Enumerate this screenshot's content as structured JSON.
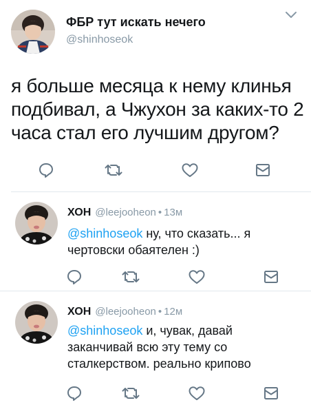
{
  "colors": {
    "text": "#14171a",
    "secondary": "#8899a6",
    "mention": "#1da1f2",
    "divider": "#e1e8ed"
  },
  "main_tweet": {
    "display_name": "ФБР тут искать нечего",
    "handle": "@shinhoseok",
    "text": "я больше месяца к нему клинья подбивал, а Чжухон за каких-то 2 часа стал его лучшим другом?",
    "menu_icon": "chevron-down-icon",
    "actions": [
      "reply-icon",
      "retweet-icon",
      "like-icon",
      "message-icon"
    ]
  },
  "replies": [
    {
      "display_name": "ХОН",
      "handle": "@leejooheon",
      "separator": "•",
      "time": "13м",
      "mention": "@shinhoseok",
      "text": " ну, что сказать... я чертовски обаятелен :)"
    },
    {
      "display_name": "ХОН",
      "handle": "@leejooheon",
      "separator": "•",
      "time": "12м",
      "mention": "@shinhoseok",
      "text": " и, чувак, давай заканчивай всю эту тему со сталкерством. реально криповo"
    }
  ]
}
